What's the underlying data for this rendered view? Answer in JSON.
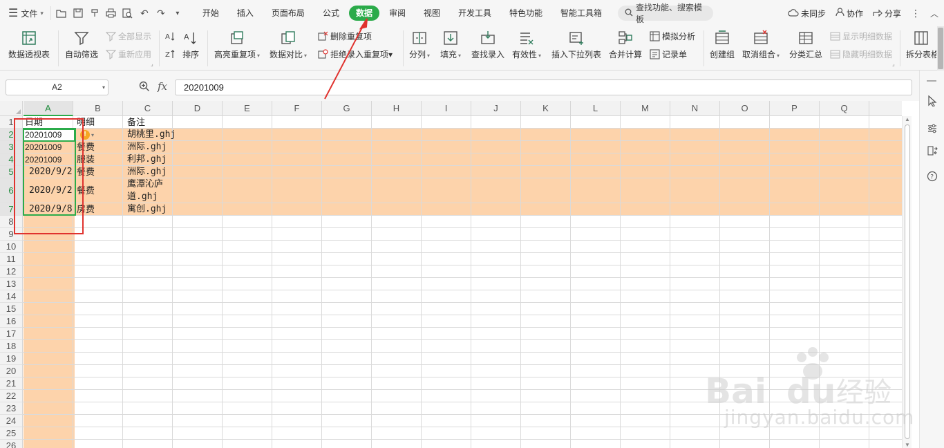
{
  "menubar": {
    "file_label": "文件",
    "tabs": [
      {
        "label": "开始"
      },
      {
        "label": "插入"
      },
      {
        "label": "页面布局"
      },
      {
        "label": "公式"
      },
      {
        "label": "数据"
      },
      {
        "label": "审阅"
      },
      {
        "label": "视图"
      },
      {
        "label": "开发工具"
      },
      {
        "label": "特色功能"
      },
      {
        "label": "智能工具箱"
      }
    ],
    "active_tab": "数据",
    "search_label": "查找功能、搜索模板",
    "sync_label": "未同步",
    "collab_label": "协作",
    "share_label": "分享"
  },
  "ribbon": {
    "pivot": "数据透视表",
    "autofilter": "自动筛选",
    "show_all": "全部显示",
    "reapply": "重新应用",
    "sort": "排序",
    "highlight_dup": "高亮重复项",
    "compare": "数据对比",
    "delete_dup": "删除重复项",
    "reject_dup": "拒绝录入重复项",
    "split": "分列",
    "fill": "填充",
    "lookup_entry": "查找录入",
    "validity": "有效性",
    "insert_dropdown": "插入下拉列表",
    "consolidate": "合并计算",
    "simulate": "模拟分析",
    "record_form": "记录单",
    "create_group": "创建组",
    "ungroup": "取消组合",
    "subtotal": "分类汇总",
    "show_detail": "显示明细数据",
    "hide_detail": "隐藏明细数据",
    "split_table": "拆分表格"
  },
  "formula": {
    "name_box": "A2",
    "fx": "fx",
    "value": "20201009"
  },
  "sheet": {
    "columns": [
      "A",
      "B",
      "C",
      "D",
      "E",
      "F",
      "G",
      "H",
      "I",
      "J",
      "K",
      "L",
      "M",
      "N",
      "O",
      "P",
      "Q"
    ],
    "rows": [
      "1",
      "2",
      "3",
      "4",
      "5",
      "6",
      "7",
      "8",
      "9",
      "10",
      "11",
      "12",
      "13",
      "14",
      "15",
      "16",
      "17",
      "18",
      "19",
      "20",
      "21",
      "22",
      "23",
      "24",
      "25",
      "26"
    ],
    "header": {
      "a": "日期",
      "b": "明细",
      "c": "备注"
    },
    "data": [
      {
        "a": "20201009",
        "b": "",
        "c": "胡桃里.ghj"
      },
      {
        "a": "20201009",
        "b": "餐费",
        "c": "洲际.ghj"
      },
      {
        "a": "20201009",
        "b": "服装",
        "c": "利邦.ghj"
      },
      {
        "a": "2020/9/2",
        "b": "餐费",
        "c": "洲际.ghj"
      },
      {
        "a": "2020/9/2",
        "b": "餐费",
        "c": "鹰潭沁庐",
        "c2": "道.ghj"
      },
      {
        "a": "2020/9/8",
        "b": "房费",
        "c": "寓创.ghj"
      }
    ]
  },
  "watermark": {
    "brand": "Bai du 经验",
    "url": "jingyan.baidu.com"
  },
  "colors": {
    "accent_green": "#2bab4a",
    "highlight_orange": "#fdd3ab",
    "annotation_red": "#e0322e"
  }
}
